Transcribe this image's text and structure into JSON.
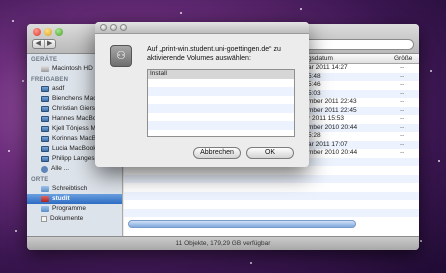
{
  "finder": {
    "nav_back": "◀",
    "nav_forward": "▶",
    "sidebar": {
      "devices_header": "GERÄTE",
      "devices": [
        {
          "label": "Macintosh HD",
          "icon": "disk-icon"
        }
      ],
      "shared_header": "FREIGABEN",
      "shared": [
        {
          "label": "asdf",
          "icon": "computer-icon"
        },
        {
          "label": "Bienchens MacBook",
          "icon": "computer-icon"
        },
        {
          "label": "Christian Giersig",
          "icon": "computer-icon"
        },
        {
          "label": "Hannes MacBook",
          "icon": "computer-icon"
        },
        {
          "label": "Kjell Tönjess Mac",
          "icon": "computer-icon"
        },
        {
          "label": "Korinnas MacBook",
          "icon": "computer-icon"
        },
        {
          "label": "Lucia MacBook",
          "icon": "computer-icon"
        },
        {
          "label": "Philipp Langes Mac",
          "icon": "computer-icon"
        },
        {
          "label": "Alle ...",
          "icon": "network-icon"
        }
      ],
      "places_header": "ORTE",
      "places": [
        {
          "label": "Schreibtisch",
          "icon": "desktop-icon",
          "selected": false
        },
        {
          "label": "studit",
          "icon": "home-icon",
          "selected": true
        },
        {
          "label": "Programme",
          "icon": "applications-icon",
          "selected": false
        },
        {
          "label": "Dokumente",
          "icon": "documents-icon",
          "selected": false
        }
      ]
    },
    "columns": {
      "date": "gsdatum",
      "size": "Größe"
    },
    "rows": [
      {
        "date": "ar 2011 14:27",
        "size": "--"
      },
      {
        "date": "5:48",
        "size": "--"
      },
      {
        "date": "5:46",
        "size": "--"
      },
      {
        "date": "5:03",
        "size": "--"
      },
      {
        "date": "mber 2011 22:43",
        "size": "--"
      },
      {
        "date": "mber 2011 22:45",
        "size": "--"
      },
      {
        "date": "r 2011 15:53",
        "size": "--"
      },
      {
        "date": "mber 2010 20:44",
        "size": "--"
      },
      {
        "date": "5:28",
        "size": "--"
      },
      {
        "date": "ar 2011 17:07",
        "size": "--"
      },
      {
        "date": "mber 2010 20:44",
        "size": "--"
      }
    ],
    "status": "11 Objekte, 179,29 GB verfügbar"
  },
  "dialog": {
    "icon_glyph": "⚇",
    "prompt": "Auf „print-win.student.uni-goettingen.de“ zu aktivierende Volumes auswählen:",
    "volumes": [
      {
        "label": "Install",
        "selected": true
      }
    ],
    "cancel_label": "Abbrechen",
    "ok_label": "OK"
  }
}
